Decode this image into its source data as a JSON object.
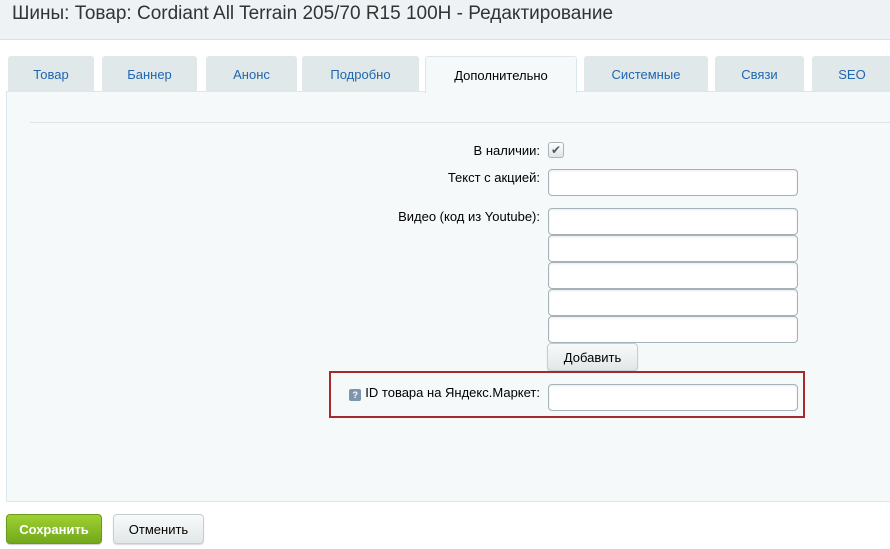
{
  "page": {
    "title": "Шины: Товар: Cordiant All Terrain 205/70 R15 100H - Редактирование"
  },
  "tabs": [
    {
      "label": "Товар",
      "active": false
    },
    {
      "label": "Баннер",
      "active": false
    },
    {
      "label": "Анонс",
      "active": false
    },
    {
      "label": "Подробно",
      "active": false
    },
    {
      "label": "Дополнительно",
      "active": true
    },
    {
      "label": "Системные",
      "active": false
    },
    {
      "label": "Связи",
      "active": false
    },
    {
      "label": "SEO",
      "active": false
    }
  ],
  "form": {
    "in_stock": {
      "label": "В наличии:",
      "checked": true
    },
    "promo_text": {
      "label": "Текст с акцией:",
      "value": ""
    },
    "video": {
      "label": "Видео (код из Youtube):",
      "values": [
        "",
        "",
        "",
        "",
        ""
      ],
      "add_button": "Добавить"
    },
    "yandex_market_id": {
      "label": "ID товара на Яндекс.Маркет:",
      "value": "",
      "help_icon": "question-icon"
    }
  },
  "footer": {
    "save_label": "Сохранить",
    "cancel_label": "Отменить"
  },
  "colors": {
    "save_button": "#82b524",
    "highlight_border": "#a52a2a",
    "tab_text": "#2067b0"
  }
}
